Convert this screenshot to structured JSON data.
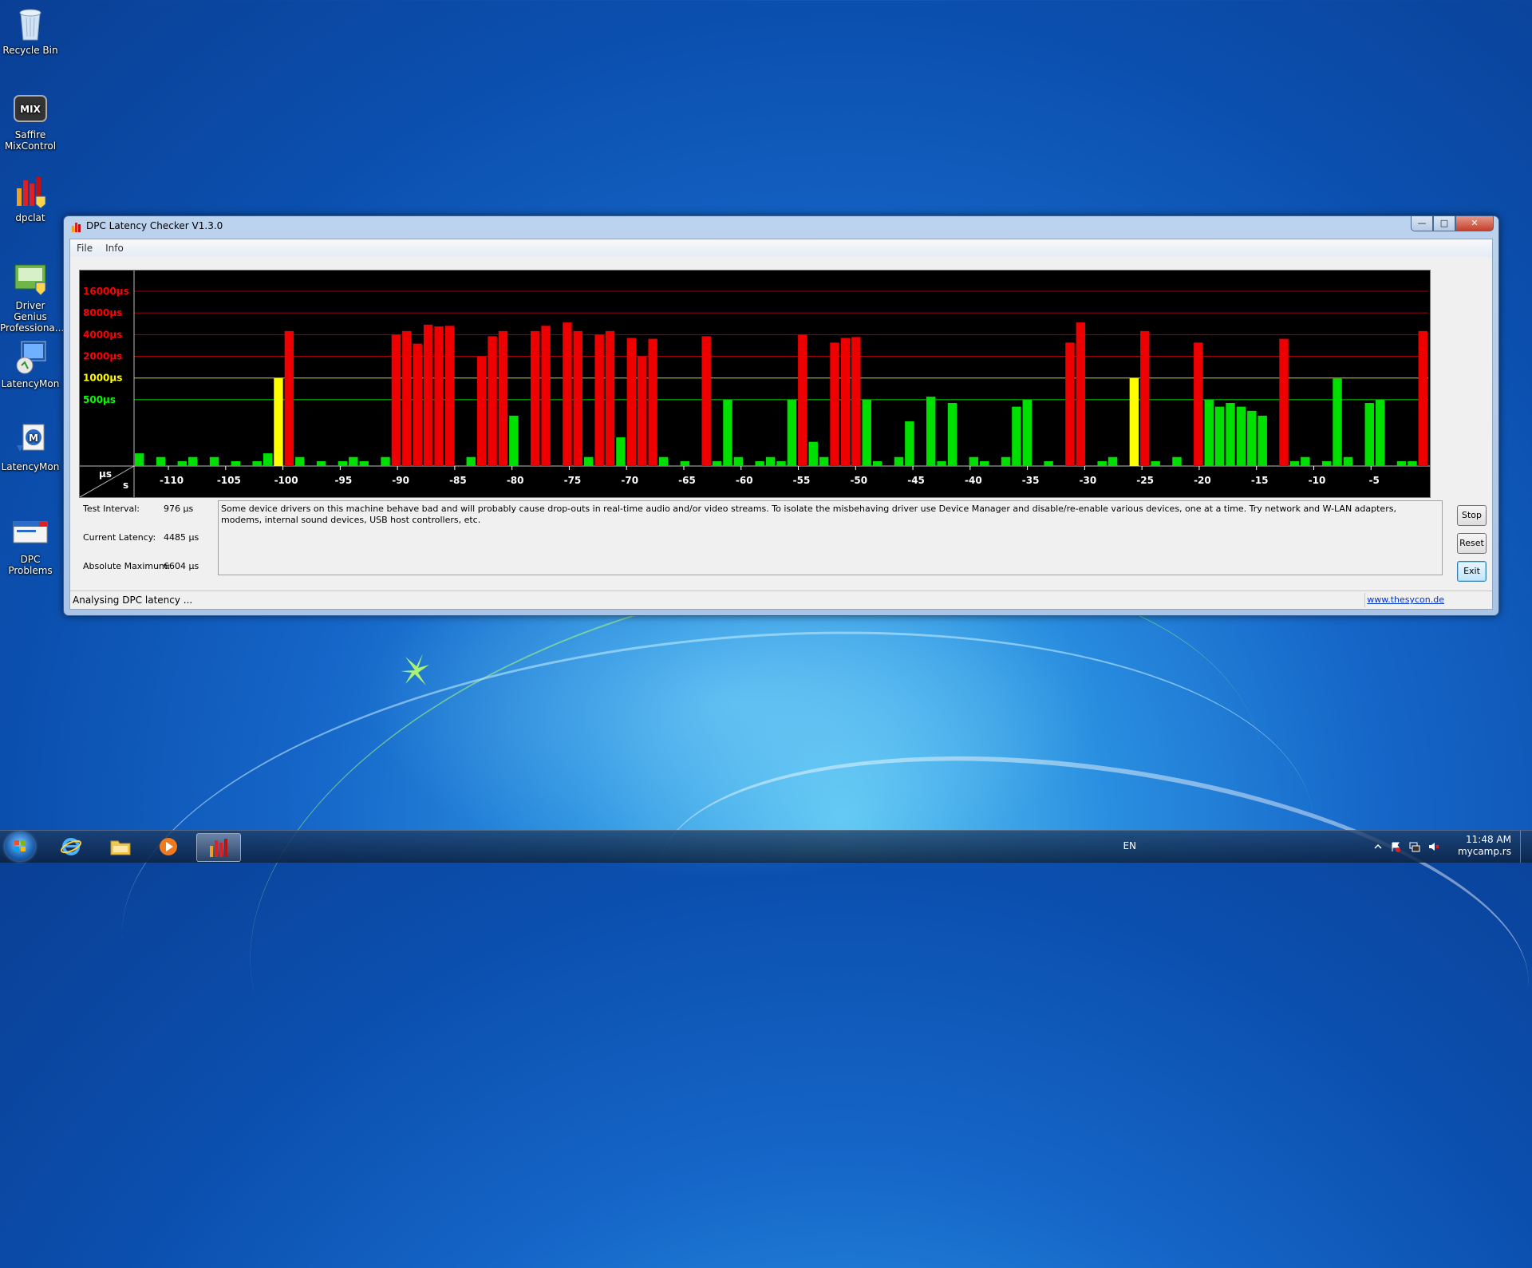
{
  "desktop": {
    "icons": [
      {
        "label": "Recycle Bin",
        "icon": "recycle-bin-icon"
      },
      {
        "label": "Saffire MixControl",
        "icon": "saffire-mixcontrol-icon"
      },
      {
        "label": "dpclat",
        "icon": "dpclat-icon"
      },
      {
        "label": "Driver Genius Professiona...",
        "icon": "driver-genius-icon"
      },
      {
        "label": "LatencyMon",
        "icon": "latencymon-icon"
      },
      {
        "label": "LatencyMon",
        "icon": "latencymon-icon"
      },
      {
        "label": "DPC Problems",
        "icon": "dpc-problems-icon"
      }
    ]
  },
  "window": {
    "title": "DPC Latency Checker V1.3.0",
    "menu": [
      "File",
      "Info"
    ],
    "info": {
      "test_interval_label": "Test Interval:",
      "test_interval_value": "976 µs",
      "current_latency_label": "Current Latency:",
      "current_latency_value": "4485 µs",
      "absolute_max_label": "Absolute Maximum:",
      "absolute_max_value": "6604 µs"
    },
    "message": "Some device drivers on this machine behave bad and will probably cause drop-outs in real-time audio and/or video streams. To isolate the misbehaving driver use Device Manager and disable/re-enable various devices, one at a time. Try network and W-LAN adapters, modems, internal sound devices, USB host controllers, etc.",
    "buttons": {
      "stop": "Stop",
      "reset": "Reset",
      "exit": "Exit"
    },
    "status": "Analysing DPC latency ...",
    "link": "www.thesycon.de"
  },
  "chart_data": {
    "type": "bar",
    "y_unit_label": "µs",
    "x_unit_label": "s",
    "y_ticks": [
      {
        "label": "16000µs",
        "value": 16000,
        "color": "#ff0000"
      },
      {
        "label": "8000µs",
        "value": 8000,
        "color": "#ff0000"
      },
      {
        "label": "4000µs",
        "value": 4000,
        "color": "#ff0000"
      },
      {
        "label": "2000µs",
        "value": 2000,
        "color": "#ff0000"
      },
      {
        "label": "1000µs",
        "value": 1000,
        "color": "#ffff00"
      },
      {
        "label": "500µs",
        "value": 500,
        "color": "#00ff00"
      }
    ],
    "x_ticks": [
      -110,
      -105,
      -100,
      -95,
      -90,
      -85,
      -80,
      -75,
      -70,
      -65,
      -60,
      -55,
      -50,
      -45,
      -40,
      -35,
      -30,
      -25,
      -20,
      -15,
      -10,
      -5
    ],
    "x_range": [
      -113,
      0
    ],
    "y_scale": "log",
    "thresholds": {
      "yellow_from": 1000,
      "red_from": 2000
    },
    "bar_colors": {
      "green": "#00e000",
      "yellow": "#ffff00",
      "red": "#ee0000"
    },
    "values": [
      90,
      60,
      80,
      60,
      70,
      80,
      60,
      80,
      60,
      70,
      60,
      70,
      90,
      1000,
      4485,
      80,
      60,
      70,
      60,
      70,
      80,
      70,
      60,
      80,
      4000,
      4485,
      3000,
      5500,
      5200,
      5300,
      60,
      80,
      2000,
      3800,
      4485,
      300,
      60,
      4485,
      5300,
      60,
      5900,
      4485,
      80,
      4000,
      4485,
      150,
      3600,
      2000,
      3500,
      80,
      60,
      70,
      60,
      3800,
      70,
      500,
      80,
      60,
      70,
      80,
      70,
      500,
      4000,
      130,
      80,
      3100,
      3600,
      3700,
      500,
      70,
      60,
      80,
      250,
      60,
      550,
      70,
      450,
      60,
      80,
      70,
      60,
      80,
      400,
      500,
      60,
      70,
      60,
      3100,
      5900,
      60,
      70,
      80,
      60,
      1000,
      4485,
      70,
      60,
      80,
      60,
      3100,
      500,
      400,
      450,
      400,
      350,
      300,
      60,
      3500,
      70,
      80,
      60,
      70,
      980,
      80,
      60,
      450,
      500,
      60,
      70,
      70,
      4485
    ]
  },
  "taskbar": {
    "pinned": [
      "start-orb",
      "internet-explorer-icon",
      "windows-explorer-icon",
      "media-player-icon",
      "dpclat-icon"
    ],
    "language": "EN",
    "time": "11:48 AM",
    "date_overlay": "mycamp.rs"
  }
}
